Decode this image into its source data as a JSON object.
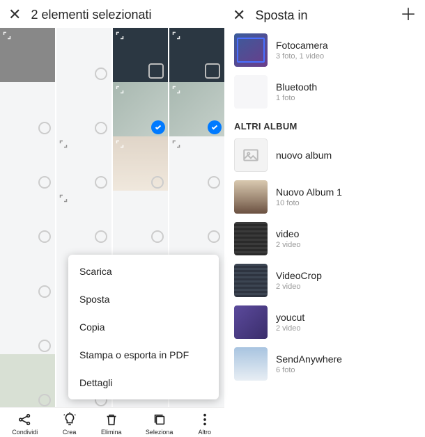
{
  "left": {
    "title": "2 elementi selezionati",
    "menu": [
      "Scarica",
      "Sposta",
      "Copia",
      "Stampa o esporta in PDF",
      "Dettagli"
    ],
    "toolbar": [
      {
        "label": "Condividi"
      },
      {
        "label": "Crea"
      },
      {
        "label": "Elimina"
      },
      {
        "label": "Seleziona"
      },
      {
        "label": "Altro"
      }
    ]
  },
  "right": {
    "title": "Sposta in",
    "section": "ALTRI ALBUM",
    "albums_top": [
      {
        "name": "Fotocamera",
        "meta": "3 foto,  1 video"
      },
      {
        "name": "Bluetooth",
        "meta": "1 foto"
      }
    ],
    "albums_other": [
      {
        "name": "nuovo album",
        "meta": ""
      },
      {
        "name": "Nuovo Album 1",
        "meta": "10 foto"
      },
      {
        "name": "video",
        "meta": "2 video"
      },
      {
        "name": "VideoCrop",
        "meta": "2 video"
      },
      {
        "name": "youcut",
        "meta": "2 video"
      },
      {
        "name": "SendAnywhere",
        "meta": "6 foto"
      }
    ]
  }
}
